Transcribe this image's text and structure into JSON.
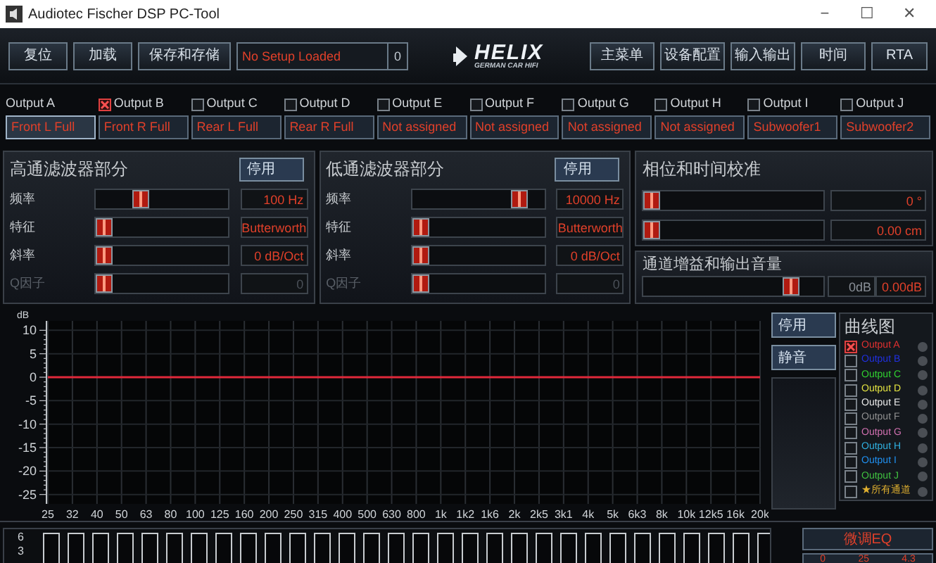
{
  "window": {
    "title": "Audiotec Fischer DSP PC-Tool",
    "controls": [
      "−",
      "☐",
      "✕"
    ]
  },
  "toolbar": {
    "left_buttons": [
      "复位",
      "加载",
      "保存和存储"
    ],
    "setup_status": "No Setup Loaded",
    "setup_number": "0",
    "logo": {
      "name": "HELIX",
      "tagline": "GERMAN CAR HIFI"
    },
    "right_buttons": [
      "主菜单",
      "设备配置",
      "输入输出",
      "时间",
      "RTA"
    ]
  },
  "outputs": [
    {
      "label": "Output A",
      "assignment": "Front L Full",
      "selected": true
    },
    {
      "label": "Output B",
      "assignment": "Front R Full",
      "checked": true,
      "selected": false
    },
    {
      "label": "Output C",
      "assignment": "Rear L Full",
      "checked": false,
      "selected": false
    },
    {
      "label": "Output D",
      "assignment": "Rear R Full",
      "checked": false,
      "selected": false
    },
    {
      "label": "Output E",
      "assignment": "Not assigned",
      "checked": false,
      "selected": false
    },
    {
      "label": "Output F",
      "assignment": "Not assigned",
      "checked": false,
      "selected": false
    },
    {
      "label": "Output G",
      "assignment": "Not assigned",
      "checked": false,
      "selected": false
    },
    {
      "label": "Output H",
      "assignment": "Not assigned",
      "checked": false,
      "selected": false
    },
    {
      "label": "Output I",
      "assignment": "Subwoofer1",
      "checked": false,
      "selected": false
    },
    {
      "label": "Output J",
      "assignment": "Subwoofer2",
      "checked": false,
      "selected": false
    }
  ],
  "highpass": {
    "title": "高通滤波器部分",
    "button": "停用",
    "rows": [
      {
        "label": "频率",
        "level": 0.32,
        "value": "100 Hz",
        "disabled": false
      },
      {
        "label": "特征",
        "level": 0,
        "value": "Butterworth",
        "disabled": false
      },
      {
        "label": "斜率",
        "level": 0,
        "value": "0 dB/Oct",
        "disabled": false
      },
      {
        "label": "Q因子",
        "level": 0,
        "value": "0",
        "disabled": true
      }
    ]
  },
  "lowpass": {
    "title": "低通滤波器部分",
    "button": "停用",
    "rows": [
      {
        "label": "频率",
        "level": 0.86,
        "value": "10000 Hz",
        "disabled": false
      },
      {
        "label": "特征",
        "level": 0,
        "value": "Butterworth",
        "disabled": false
      },
      {
        "label": "斜率",
        "level": 0,
        "value": "0 dB/Oct",
        "disabled": false
      },
      {
        "label": "Q因子",
        "level": 0,
        "value": "0",
        "disabled": true
      }
    ]
  },
  "phase": {
    "title": "相位和时间校准",
    "rows": [
      {
        "level": 0,
        "value": "0 °"
      },
      {
        "level": 0,
        "value": "0.00 cm"
      }
    ]
  },
  "gain": {
    "title": "通道增益和输出音量",
    "level": 0.85,
    "reference": "0dB",
    "value": "0.00dB"
  },
  "response_chart": {
    "chart_data": {
      "type": "line",
      "ylabel": "dB",
      "categories": [
        "25",
        "32",
        "40",
        "50",
        "63",
        "80",
        "100",
        "125",
        "160",
        "200",
        "250",
        "315",
        "400",
        "500",
        "630",
        "800",
        "1k",
        "1k2",
        "1k6",
        "2k",
        "2k5",
        "3k1",
        "4k",
        "5k",
        "6k3",
        "8k",
        "10k",
        "12k5",
        "16k",
        "20k"
      ],
      "ylim": [
        -27,
        12
      ],
      "yticks": [
        10,
        5,
        0,
        -5,
        -10,
        -15,
        -20,
        -25
      ],
      "grid": true,
      "series": [
        {
          "color": "#e0283a",
          "values": [
            0,
            0,
            0,
            0,
            0,
            0,
            0,
            0,
            0,
            0,
            0,
            0,
            0,
            0,
            0,
            0,
            0,
            0,
            0,
            0,
            0,
            0,
            0,
            0,
            0,
            0,
            0,
            0,
            0,
            0
          ]
        }
      ]
    }
  },
  "chart_buttons": [
    "停用",
    "静音"
  ],
  "curves": {
    "title": "曲线图",
    "items": [
      {
        "label": "Output A",
        "color": "#e03030",
        "checked": true
      },
      {
        "label": "Output B",
        "color": "#2030e0",
        "checked": false
      },
      {
        "label": "Output C",
        "color": "#30d030",
        "checked": false
      },
      {
        "label": "Output D",
        "color": "#e0e040",
        "checked": false
      },
      {
        "label": "Output E",
        "color": "#e8e8e8",
        "checked": false
      },
      {
        "label": "Output F",
        "color": "#909090",
        "checked": false
      },
      {
        "label": "Output G",
        "color": "#d070b0",
        "checked": false
      },
      {
        "label": "Output H",
        "color": "#30b0e0",
        "checked": false
      },
      {
        "label": "Output I",
        "color": "#2090f0",
        "checked": false
      },
      {
        "label": "Output J",
        "color": "#40c040",
        "checked": false
      },
      {
        "label": "★所有通道",
        "color": "#e0b030",
        "checked": false
      }
    ]
  },
  "eq": {
    "yticks": [
      "6",
      "3"
    ],
    "button": "微调EQ",
    "readouts": [
      "0",
      "25",
      "4.3"
    ]
  }
}
